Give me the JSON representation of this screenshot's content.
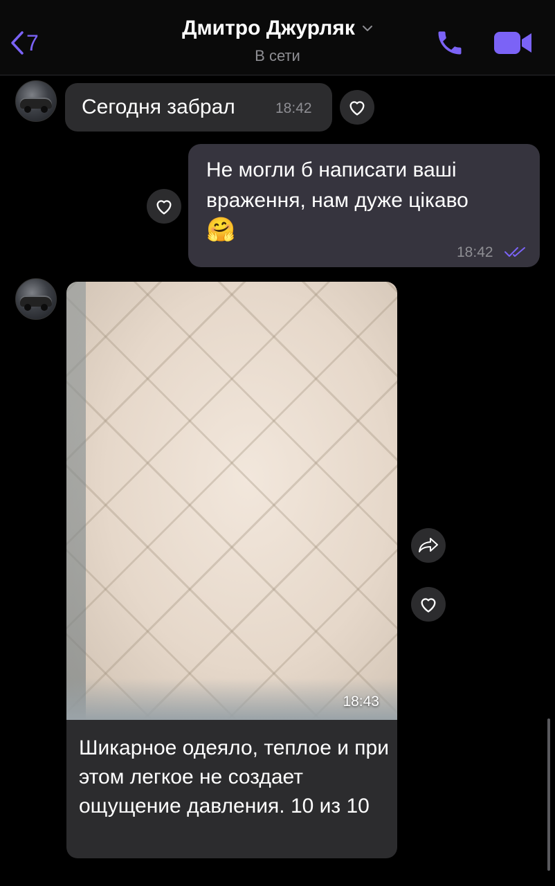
{
  "header": {
    "back_count": "7",
    "contact_name": "Дмитро Джурляк",
    "status": "В сети",
    "colors": {
      "accent": "#7b63f6"
    }
  },
  "messages": [
    {
      "direction": "incoming",
      "text": "Сегодня забрал",
      "time": "18:42"
    },
    {
      "direction": "outgoing",
      "text": "Не могли б написати ваші враження, нам дуже цікаво",
      "emoji": "🤗",
      "time": "18:42",
      "status_icon": "double-check-icon"
    },
    {
      "direction": "incoming",
      "type": "photo",
      "photo_description_icon": "image-blanket",
      "time": "18:43",
      "caption": "Шикарное одеяло, теплое и при этом легкое не создает ощущение давления. 10 из 10"
    }
  ]
}
